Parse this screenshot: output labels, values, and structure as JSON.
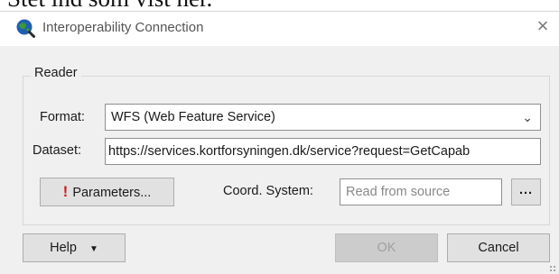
{
  "background_text": "Stet ind som vist her.",
  "dialog": {
    "title": "Interoperability Connection",
    "close_symbol": "×"
  },
  "reader": {
    "group_label": "Reader",
    "format_label": "Format:",
    "format_value": "WFS (Web Feature Service)",
    "dataset_label": "Dataset:",
    "dataset_value": "https://services.kortforsyningen.dk/service?request=GetCapab",
    "parameters_label": "Parameters...",
    "coord_system_label": "Coord. System:",
    "coord_system_placeholder": "Read from source",
    "coord_browse_label": "..."
  },
  "buttons": {
    "help_label": "Help",
    "ok_label": "OK",
    "cancel_label": "Cancel"
  },
  "icons": {
    "app": "globe-magnifier-icon",
    "close": "close-icon",
    "dropdown": "chevron-down-icon",
    "warning": "exclamation-icon",
    "help_menu": "caret-down-icon"
  },
  "colors": {
    "warning": "#c81e1e",
    "app_icon_blue": "#1f5fb0",
    "app_icon_green": "#3a9a2f"
  }
}
